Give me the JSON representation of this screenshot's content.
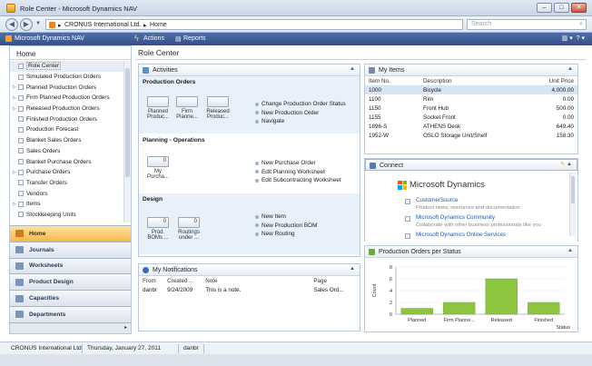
{
  "window": {
    "title": "Role Center - Microsoft Dynamics NAV",
    "buttons": [
      "–",
      "□",
      "✕"
    ]
  },
  "address": {
    "company": "CRONUS International Ltd.",
    "page": "Home",
    "search_placeholder": "Search"
  },
  "command_bar": {
    "app": "Microsoft Dynamics NAV",
    "actions": "Actions",
    "reports": "Reports",
    "help": "?"
  },
  "nav": {
    "header": "Home",
    "tree": [
      "Role Center",
      "Simulated Production Orders",
      "Planned Production Orders",
      "Firm Planned Production Orders",
      "Released Production Orders",
      "Finished Production Orders",
      "Production Forecast",
      "Blanket Sales Orders",
      "Sales Orders",
      "Blanket Purchase Orders",
      "Purchase Orders",
      "Transfer Orders",
      "Vendors",
      "Items",
      "Stockkeeping Units"
    ],
    "buttons": [
      "Home",
      "Journals",
      "Worksheets",
      "Product Design",
      "Capacities",
      "Departments"
    ]
  },
  "page_title": "Role Center",
  "activities": {
    "title": "Activities",
    "production": {
      "heading": "Production Orders",
      "cues": [
        {
          "label": "Planned",
          "label2": "Produc..."
        },
        {
          "label": "Firm",
          "label2": "Planne..."
        },
        {
          "label": "Released",
          "label2": "Produc..."
        }
      ],
      "actions": [
        "Change Production Order Status",
        "New Production Order",
        "Navigate"
      ]
    },
    "planning": {
      "heading": "Planning - Operations",
      "cues": [
        {
          "value": "0",
          "label": "My",
          "label2": "Purcha..."
        }
      ],
      "actions": [
        "New Purchase Order",
        "Edit Planning Worksheet",
        "Edit Subcontracting Worksheet"
      ]
    },
    "design": {
      "heading": "Design",
      "cues": [
        {
          "value": "0",
          "label": "Prod.",
          "label2": "BOMs ..."
        },
        {
          "value": "0",
          "label": "Routings",
          "label2": "under ..."
        }
      ],
      "actions": [
        "New Item",
        "New Production BOM",
        "New Routing"
      ]
    }
  },
  "notifications": {
    "title": "My Notifications",
    "columns": [
      "From",
      "Created ...",
      "Note",
      "Page"
    ],
    "rows": [
      [
        "danbr",
        "9/24/2009",
        "This is a note.",
        "Sales Ord..."
      ]
    ]
  },
  "my_items": {
    "title": "My Items",
    "columns": [
      "Item No.",
      "Description",
      "Unit Price"
    ],
    "rows": [
      [
        "1000",
        "Bicycle",
        "4,000.00"
      ],
      [
        "1100",
        "Rim",
        "0.00"
      ],
      [
        "1150",
        "Front Hub",
        "500.00"
      ],
      [
        "1155",
        "Socket Front",
        "0.00"
      ],
      [
        "1896-S",
        "ATHENS Desk",
        "649.40"
      ],
      [
        "1952-W",
        "OSLO Storage Unit/Shelf",
        "158.30"
      ]
    ]
  },
  "connect": {
    "title": "Connect",
    "brand": "Microsoft Dynamics",
    "links": [
      {
        "title": "CustomerSource",
        "desc": "Product news, resources and documentation"
      },
      {
        "title": "Microsoft Dynamics Community",
        "desc": "Collaborate with other business professionals like you"
      },
      {
        "title": "Microsoft Dynamics Online Services",
        "desc": ""
      }
    ]
  },
  "chart": {
    "title": "Production Orders per Status"
  },
  "chart_data": {
    "type": "bar",
    "categories": [
      "Planned",
      "Firm Planne...",
      "Released",
      "Finished"
    ],
    "values": [
      1,
      2,
      6,
      2
    ],
    "ylabel": "Count",
    "xlabel": "Status",
    "ylim": [
      0,
      8
    ],
    "yticks": [
      0,
      2,
      4,
      6,
      8
    ],
    "color": "#8cc63f"
  },
  "statusbar": {
    "company": "CRONUS International Ltd.",
    "date": "Thursday, January 27, 2011",
    "user": "danbr"
  }
}
